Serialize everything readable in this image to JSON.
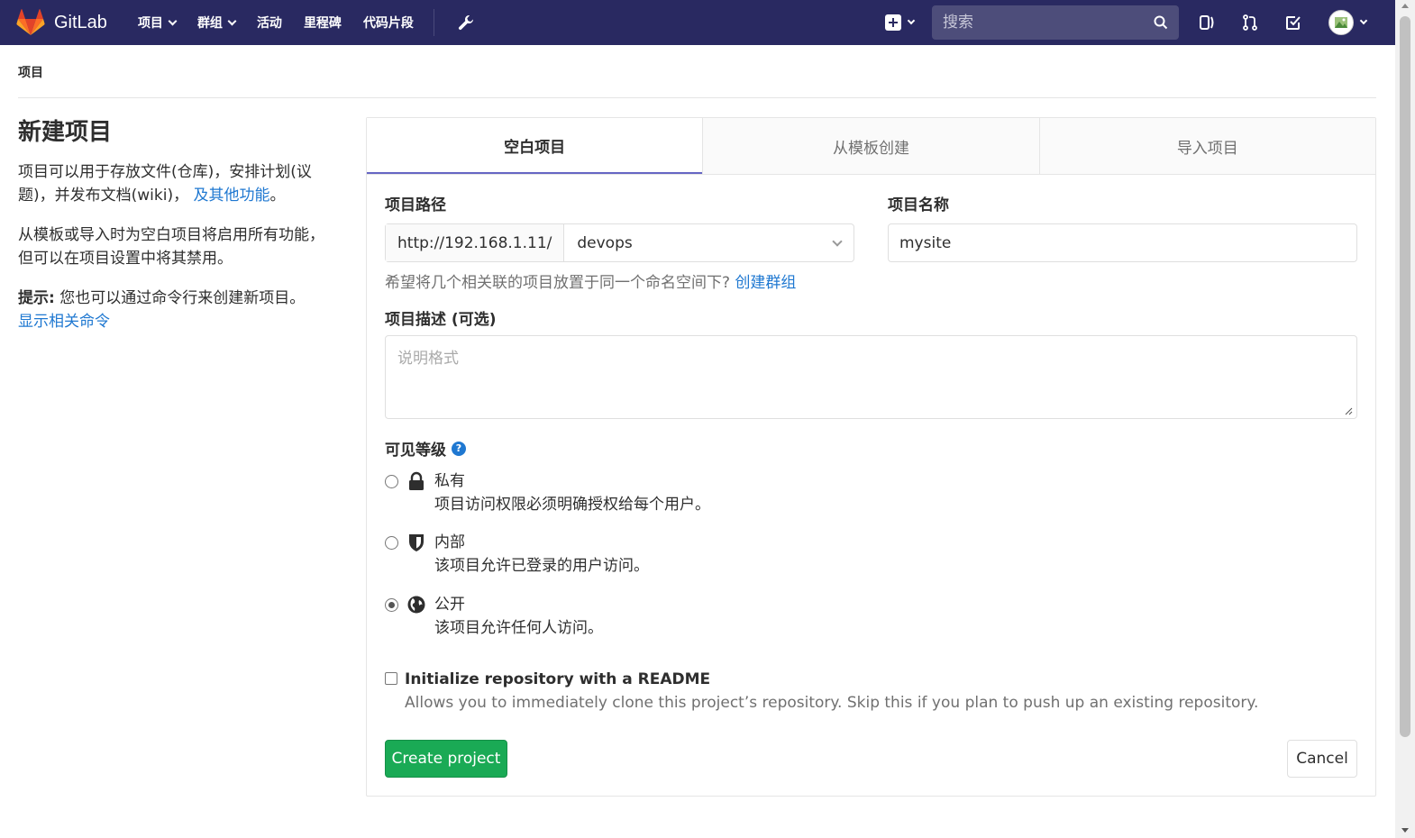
{
  "nav": {
    "brand": "GitLab",
    "links": [
      {
        "label": "项目",
        "has_caret": true
      },
      {
        "label": "群组",
        "has_caret": true
      },
      {
        "label": "活动",
        "has_caret": false
      },
      {
        "label": "里程碑",
        "has_caret": false
      },
      {
        "label": "代码片段",
        "has_caret": false
      }
    ],
    "search_placeholder": "搜索",
    "icons": [
      "wrench-icon",
      "plus-square-icon",
      "search-icon",
      "issues-icon",
      "merge-request-icon",
      "todo-icon",
      "avatar"
    ]
  },
  "breadcrumb": "项目",
  "left": {
    "title": "新建项目",
    "para1_text": "项目可以用于存放文件(仓库)，安排计划(议题)，并发布文档(wiki)，",
    "para1_link": "及其他功能",
    "para1_end": "。",
    "para2": "从模板或导入时为空白项目将启用所有功能，但可以在项目设置中将其禁用。",
    "tip_label": "提示:",
    "tip_text": "您也可以通过命令行来创建新项目。",
    "tip_link": "显示相关命令"
  },
  "tabs": [
    {
      "label": "空白项目",
      "active": true
    },
    {
      "label": "从模板创建",
      "active": false
    },
    {
      "label": "导入项目",
      "active": false
    }
  ],
  "form": {
    "path_label": "项目路径",
    "path_prefix": "http://192.168.1.11/",
    "namespace": "devops",
    "name_label": "项目名称",
    "name_value": "mysite",
    "help_text": "希望将几个相关联的项目放置于同一个命名空间下?",
    "help_link": "创建群组",
    "desc_label": "项目描述 (可选)",
    "desc_placeholder": "说明格式",
    "visibility_label": "可见等级",
    "visibility_options": [
      {
        "title": "私有",
        "desc": "项目访问权限必须明确授权给每个用户。",
        "icon": "lock-icon",
        "checked": false
      },
      {
        "title": "内部",
        "desc": "该项目允许已登录的用户访问。",
        "icon": "shield-icon",
        "checked": false
      },
      {
        "title": "公开",
        "desc": "该项目允许任何人访问。",
        "icon": "globe-icon",
        "checked": true
      }
    ],
    "readme_title": "Initialize repository with a README",
    "readme_desc": "Allows you to immediately clone this project’s repository. Skip this if you plan to push up an existing repository.",
    "create_button": "Create project",
    "cancel_button": "Cancel"
  },
  "colors": {
    "navbar": "#292961",
    "link": "#1f78d1",
    "create_button": "#1aaa55",
    "tab_active_border": "#6666c4"
  }
}
